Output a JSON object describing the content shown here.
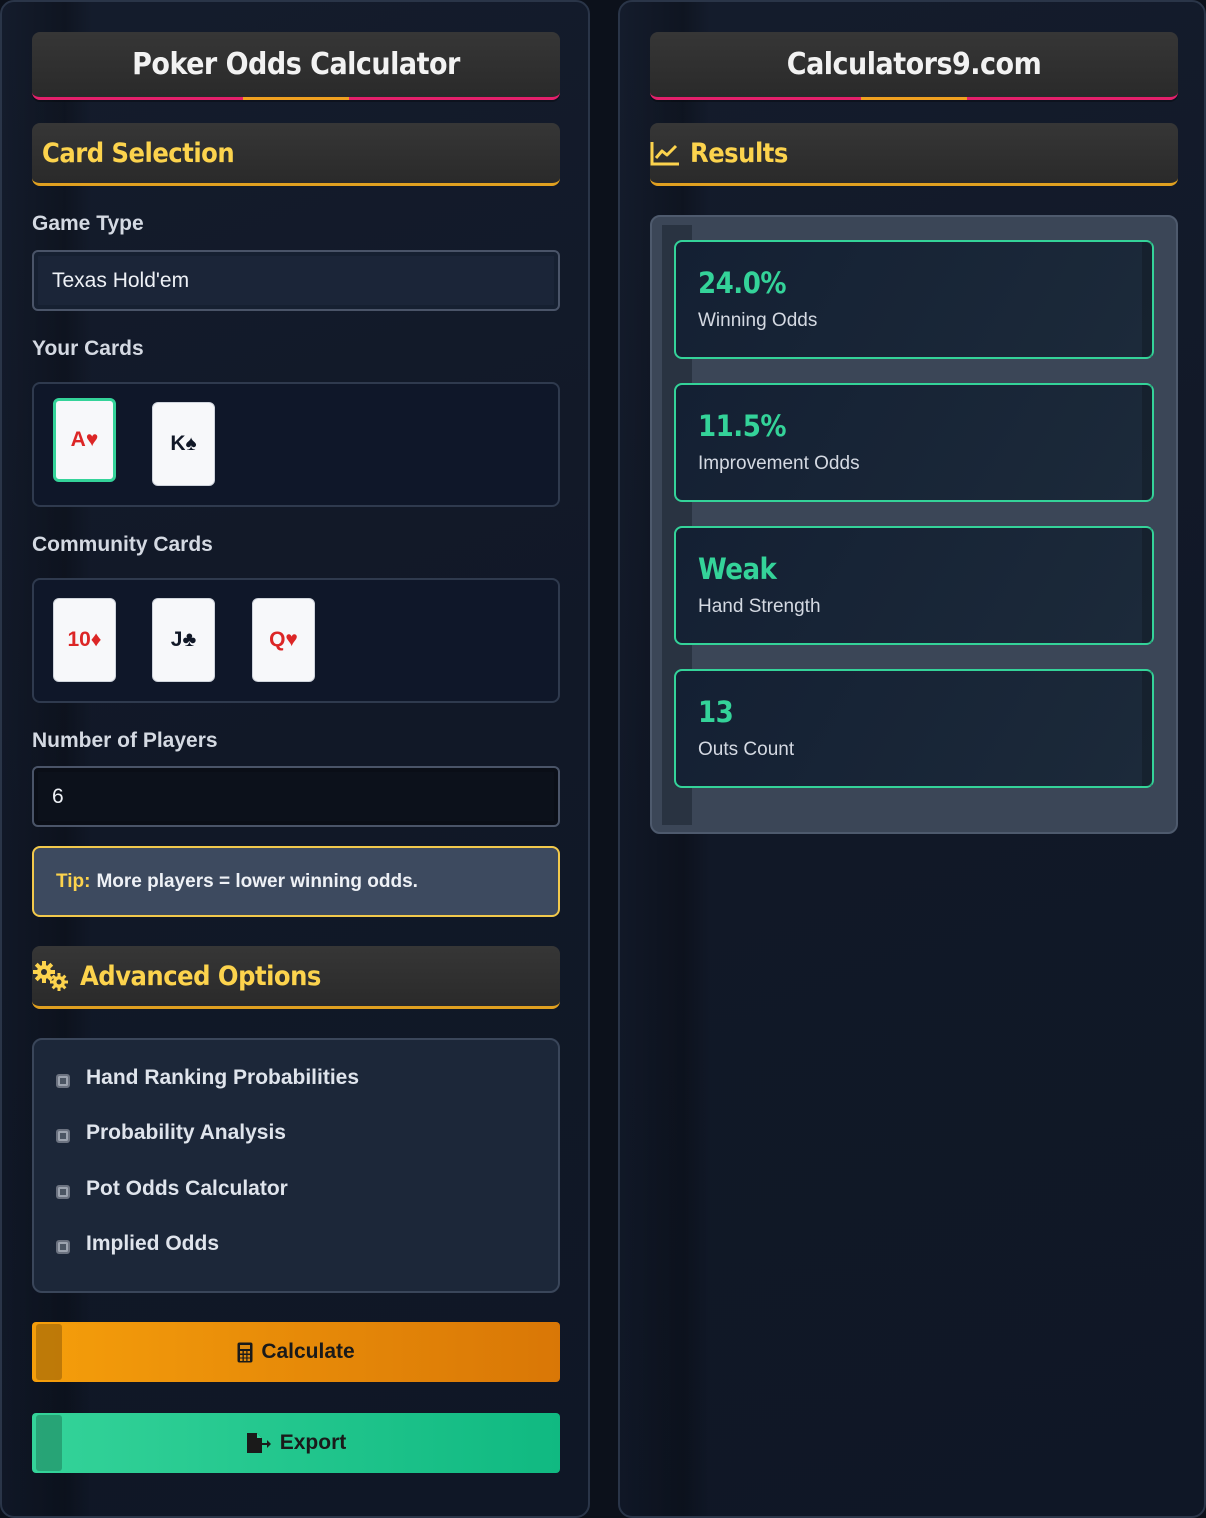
{
  "left_panel": {
    "title": "Poker Odds Calculator",
    "card_selection_heading": "Card Selection",
    "game_type": {
      "label": "Game Type",
      "value": "Texas Hold'em"
    },
    "your_cards": {
      "label": "Your Cards",
      "cards": [
        {
          "rank_suit": "A♥",
          "color": "red",
          "selected": true
        },
        {
          "rank_suit": "K♠",
          "color": "black",
          "selected": false
        }
      ]
    },
    "community_cards": {
      "label": "Community Cards",
      "cards": [
        {
          "rank_suit": "10♦",
          "color": "red"
        },
        {
          "rank_suit": "J♣",
          "color": "black"
        },
        {
          "rank_suit": "Q♥",
          "color": "red"
        }
      ]
    },
    "players": {
      "label": "Number of Players",
      "value": "6"
    },
    "tip": {
      "key": "Tip:",
      "text": "More players = lower winning odds."
    },
    "advanced": {
      "heading": "Advanced Options",
      "icon": "gears-icon",
      "options": [
        "Hand Ranking Probabilities",
        "Probability Analysis",
        "Pot Odds Calculator",
        "Implied Odds"
      ]
    },
    "buttons": {
      "calculate": {
        "label": "Calculate",
        "icon": "calculator-icon",
        "color": "#f59e0b"
      },
      "export": {
        "label": "Export",
        "icon": "file-export-icon",
        "color": "#34d399"
      }
    }
  },
  "right_panel": {
    "title": "Calculators9.com",
    "results_heading": "Results",
    "results_icon": "chart-line-icon",
    "results": [
      {
        "value": "24.0%",
        "label": "Winning Odds"
      },
      {
        "value": "11.5%",
        "label": "Improvement Odds"
      },
      {
        "value": "Weak",
        "label": "Hand Strength"
      },
      {
        "value": "13",
        "label": "Outs Count"
      }
    ]
  },
  "colors": {
    "accent_yellow": "#fcd34d",
    "accent_green": "#34d399",
    "accent_pink": "#e4206b",
    "card_red": "#dc2626"
  }
}
